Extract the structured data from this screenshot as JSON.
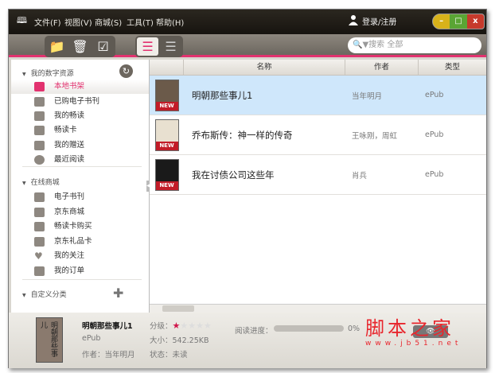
{
  "menu": [
    "文件(F)",
    "视图(V)",
    "商城(S)",
    "工具(T)",
    "帮助(H)"
  ],
  "login": "登录/注册",
  "window_buttons": [
    "–",
    "□",
    "x"
  ],
  "search_placeholder": "▼搜索 全部",
  "sidebar": {
    "sections": [
      "我的数字资源",
      "在线商城",
      "自定义分类"
    ],
    "items_resources": [
      "本地书架",
      "已购电子书刊",
      "我的畅读",
      "畅读卡",
      "我的赠送",
      "最近阅读"
    ],
    "items_store": [
      "电子书刊",
      "京东商城",
      "畅读卡购买",
      "京东礼品卡",
      "我的关注",
      "我的订单"
    ]
  },
  "table": {
    "headers": [
      "",
      "名称",
      "作者",
      "类型"
    ],
    "rows": [
      {
        "name": "明朝那些事儿1",
        "author": "当年明月",
        "type": "ePub",
        "badge": "NEW"
      },
      {
        "name": "乔布斯传：神一样的传奇",
        "author": "王咏刚，周虹",
        "type": "ePub",
        "badge": "NEW"
      },
      {
        "name": "我在讨债公司这些年",
        "author": "肖兵",
        "type": "ePub",
        "badge": "NEW"
      }
    ]
  },
  "detail": {
    "title": "明朝那些事儿1",
    "format": "ePub",
    "author": "作者：当年明月",
    "rating_label": "分级：",
    "rating": 1,
    "rating_max": 5,
    "size": "大小：542.25KB",
    "status": "状态：未读",
    "progress_label": "阅读进度：",
    "progress": "0%",
    "progress_value": 0,
    "cover_text": "明朝那些事儿"
  },
  "watermark": {
    "text": "脚本之家",
    "url": "www.jb51.net"
  }
}
